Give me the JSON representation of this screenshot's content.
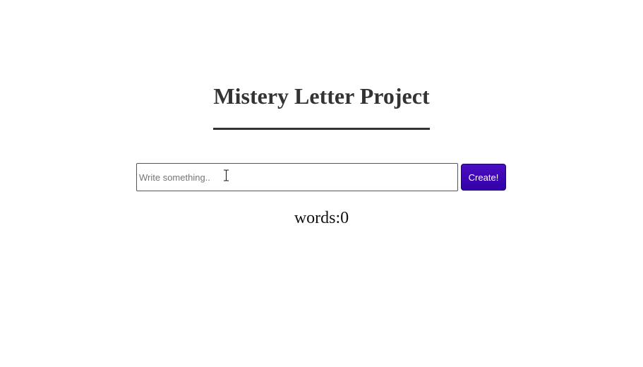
{
  "header": {
    "title": "Mistery Letter Project"
  },
  "form": {
    "input_value": "",
    "input_placeholder": "Write something..",
    "create_label": "Create!"
  },
  "counter": {
    "text": "words:0"
  },
  "icons": {
    "cursor": "text-cursor-icon"
  }
}
